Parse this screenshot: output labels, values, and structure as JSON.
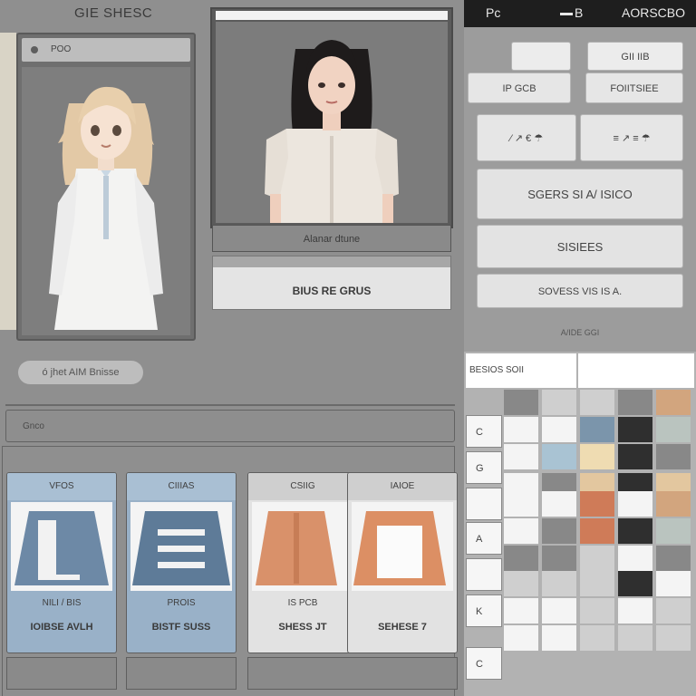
{
  "header": {
    "title": "GIE SHESC"
  },
  "character_panel_1": {
    "label": "POO"
  },
  "character_panel_2": {
    "caption": "Alanar dtune",
    "action_label": "BIUS RE GRUS"
  },
  "pill_button": {
    "label": "ó jhet AIM Bnisse"
  },
  "search": {
    "placeholder": "Gnco"
  },
  "cards": [
    {
      "header": "VFOS",
      "name": "NILI / BIS",
      "price": "IOIBSE AVLH"
    },
    {
      "header": "CIIIAS",
      "name": "PROIS",
      "price": "BISTF SUSS"
    },
    {
      "header": "CSIIG",
      "name": "IS     PCB",
      "price": "SHESS JT"
    },
    {
      "header": "IAIOE",
      "name": "",
      "price": "SEHESE 7"
    }
  ],
  "topbar": {
    "left": "Pc",
    "middle": "B",
    "right": "AORSCBO"
  },
  "sidebar": {
    "chips": [
      "",
      "GII IIB"
    ],
    "row2": [
      "IP   GCB",
      "FOIITSIEE"
    ],
    "row3": [
      "⁄ ↗ € ☂",
      "≡ ↗ ≡ ☂"
    ],
    "big_buttons": [
      "SGERS SI A/ ISICO",
      "SISIEES",
      "SOVESS VIS IS A."
    ],
    "note": "A/IDE GGI"
  },
  "palette": {
    "header": "BESIOS SOII",
    "row_labels": [
      "C",
      "G",
      "",
      "A",
      "",
      "K",
      "C"
    ],
    "colors": {
      "blue_gray": "#7b95ab",
      "pale_blue": "#a9c3d3",
      "cream": "#efdcb2",
      "sand": "#e3c79f",
      "terracotta": "#cf7b58",
      "tan": "#d2a57e",
      "charcoal": "#2f2f2f",
      "mid_gray": "#888888",
      "light_gray": "#cfcfcf",
      "white": "#f4f4f4",
      "sage": "#bac4bf"
    }
  }
}
